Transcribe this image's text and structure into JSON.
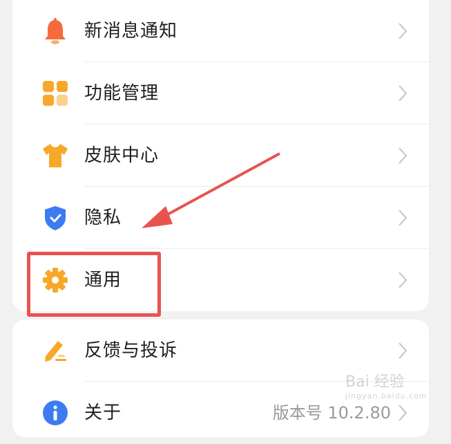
{
  "settings": {
    "items": [
      {
        "label": "新消息通知",
        "icon": "bell-icon"
      },
      {
        "label": "功能管理",
        "icon": "grid-icon"
      },
      {
        "label": "皮肤中心",
        "icon": "tshirt-icon"
      },
      {
        "label": "隐私",
        "icon": "shield-check-icon"
      },
      {
        "label": "通用",
        "icon": "gear-icon"
      }
    ],
    "items2": [
      {
        "label": "反馈与投诉",
        "icon": "edit-pen-icon"
      },
      {
        "label": "关于",
        "icon": "info-icon",
        "value": "版本号 10.2.80"
      }
    ]
  },
  "watermark": {
    "main": "Bai 经验",
    "sub": "jingyan.baidu.com"
  },
  "colors": {
    "orange": "#f7a82a",
    "red_orange": "#f56b3d",
    "blue": "#3d7bf2",
    "highlight": "#e8534f"
  }
}
